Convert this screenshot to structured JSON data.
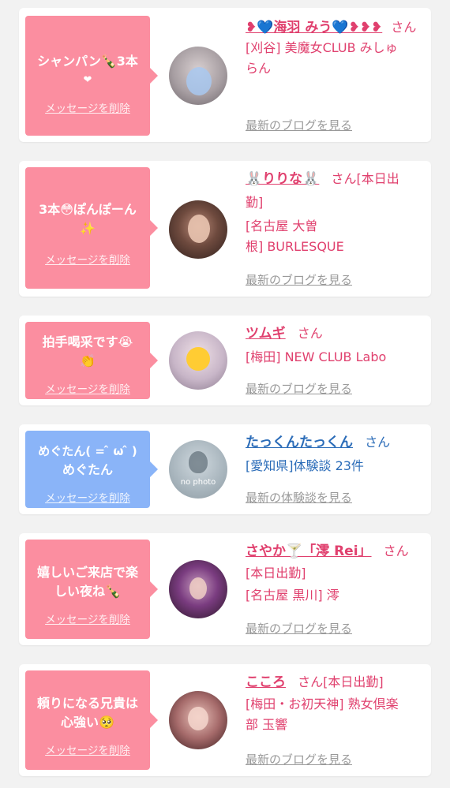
{
  "cards": [
    {
      "message": [
        "シャンパン🍾3本",
        "❤"
      ],
      "delete_label": "メッセージを削除",
      "name": "❥💙海羽 みう💙❥❥❥",
      "san": "さん",
      "name_suffix": "",
      "details": [
        "[刈谷] 美魔女CLUB みしゅ",
        "らん"
      ],
      "blog_label": "最新のブログを見る",
      "theme": "pink"
    },
    {
      "message": [
        "3本😳ぽんぽーん",
        "✨"
      ],
      "delete_label": "メッセージを削除",
      "name": "🐰りりな🐰",
      "san": "さん",
      "name_suffix": "[本日出",
      "details": [
        "勤]",
        "[名古屋 大曽",
        "根] BURLESQUE"
      ],
      "blog_label": "最新のブログを見る",
      "theme": "pink"
    },
    {
      "message": [
        "拍手喝采です😭",
        "👏"
      ],
      "delete_label": "メッセージを削除",
      "name": "ツムギ",
      "san": "さん",
      "name_suffix": "",
      "details": [
        "[梅田] NEW CLUB Labo"
      ],
      "blog_label": "最新のブログを見る",
      "theme": "pink"
    },
    {
      "message": [
        "めぐたん( = ̂ ω ̂ )",
        "めぐたん"
      ],
      "delete_label": "メッセージを削除",
      "name": "たっくんたっくん",
      "san": "さん",
      "name_suffix": "",
      "details": [
        "[愛知県]体験談 23件"
      ],
      "blog_label": "最新の体験談を見る",
      "avatar_text": "no photo",
      "theme": "blue"
    },
    {
      "message": [
        "嬉しいご来店で楽",
        "しい夜ね🍾"
      ],
      "delete_label": "メッセージを削除",
      "name": "さやか🍸「澪 Rei」",
      "san": "さん",
      "name_suffix": "",
      "details": [
        "[本日出勤]",
        "[名古屋 黒川] 澪"
      ],
      "blog_label": "最新のブログを見る",
      "theme": "pink"
    },
    {
      "message": [
        "頼りになる兄貴は",
        "心強い🥺"
      ],
      "delete_label": "メッセージを削除",
      "name": "こころ",
      "san": "さん",
      "name_suffix": "[本日出勤]",
      "details": [
        "[梅田・お初天神] 熟女倶楽",
        "部 玉響"
      ],
      "blog_label": "最新のブログを見る",
      "theme": "pink"
    }
  ]
}
